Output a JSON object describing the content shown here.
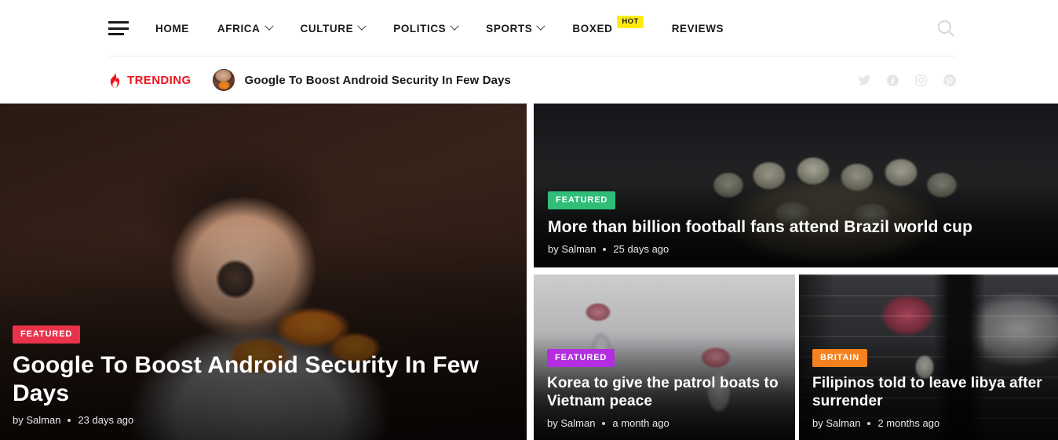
{
  "header": {
    "menu_icon": "hamburger-menu-icon",
    "search_icon": "search-icon",
    "nav": [
      {
        "label": "HOME",
        "has_caret": false,
        "badge": null
      },
      {
        "label": "AFRICA",
        "has_caret": true,
        "badge": null
      },
      {
        "label": "CULTURE",
        "has_caret": true,
        "badge": null
      },
      {
        "label": "POLITICS",
        "has_caret": true,
        "badge": null
      },
      {
        "label": "SPORTS",
        "has_caret": true,
        "badge": null
      },
      {
        "label": "BOXED",
        "has_caret": false,
        "badge": "HOT"
      },
      {
        "label": "REVIEWS",
        "has_caret": false,
        "badge": null
      }
    ]
  },
  "trending": {
    "icon": "flame-icon",
    "label": "TRENDING",
    "avatar": "article-thumbnail-avatar",
    "headline": "Google To Boost Android Security In Few Days",
    "socials": [
      {
        "name": "twitter-icon",
        "label": "Twitter"
      },
      {
        "name": "facebook-icon",
        "label": "Facebook"
      },
      {
        "name": "instagram-icon",
        "label": "Instagram"
      },
      {
        "name": "pinterest-icon",
        "label": "Pinterest"
      }
    ]
  },
  "cards": {
    "hero": {
      "badge": "FEATURED",
      "badge_color": "#e8334a",
      "title": "Google To Boost Android Security In Few Days",
      "author": "by Salman",
      "date": "23 days ago"
    },
    "wide": {
      "badge": "FEATURED",
      "badge_color": "#2fbd77",
      "title": "More than billion football fans attend Brazil world cup",
      "author": "by Salman",
      "date": "25 days ago"
    },
    "small_left": {
      "badge": "FEATURED",
      "badge_color": "#b22ee0",
      "title": "Korea to give the patrol boats to Vietnam peace",
      "author": "by Salman",
      "date": "a month ago"
    },
    "small_right": {
      "badge": "BRITAIN",
      "badge_color": "#f5811f",
      "title": "Filipinos told to leave libya after surrender",
      "author": "by Salman",
      "date": "2 months ago"
    }
  },
  "theme": {
    "trending_red": "#f0141e",
    "hot_yellow": "#ffeb12",
    "nav_text": "#17191c",
    "page_bg": "#ffffff"
  }
}
